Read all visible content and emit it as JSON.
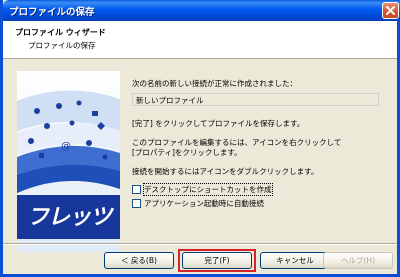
{
  "window": {
    "title": "プロファイルの保存"
  },
  "header": {
    "title": "プロファイル ウィザード",
    "subtitle": "プロファイルの保存"
  },
  "banner": {
    "logo_text": "フレッツ",
    "brand_color": "#1a3f9e"
  },
  "content": {
    "created_message": "次の名前の新しい接続が正常に作成されました：",
    "profile_name": "新しいプロファイル",
    "finish_hint": "[完了] をクリックしてプロファイルを保存します。",
    "edit_hint_line1": "このプロファイルを編集するには、アイコンを右クリックして",
    "edit_hint_line2": "[プロパティ]をクリックします。",
    "connect_hint": "接続を開始するにはアイコンをダブルクリックします。",
    "checkboxes": [
      {
        "label": "デスクトップにショートカットを作成",
        "checked": false
      },
      {
        "label": "アプリケーション起動時に自動接続",
        "checked": false
      }
    ]
  },
  "buttons": {
    "back": "＜ 戻る(B)",
    "finish": "完了(F)",
    "cancel": "キャンセル",
    "help": "ヘルプ(H)"
  },
  "colors": {
    "accent_highlight": "#d9242b",
    "titlebar": "#0058ee"
  }
}
